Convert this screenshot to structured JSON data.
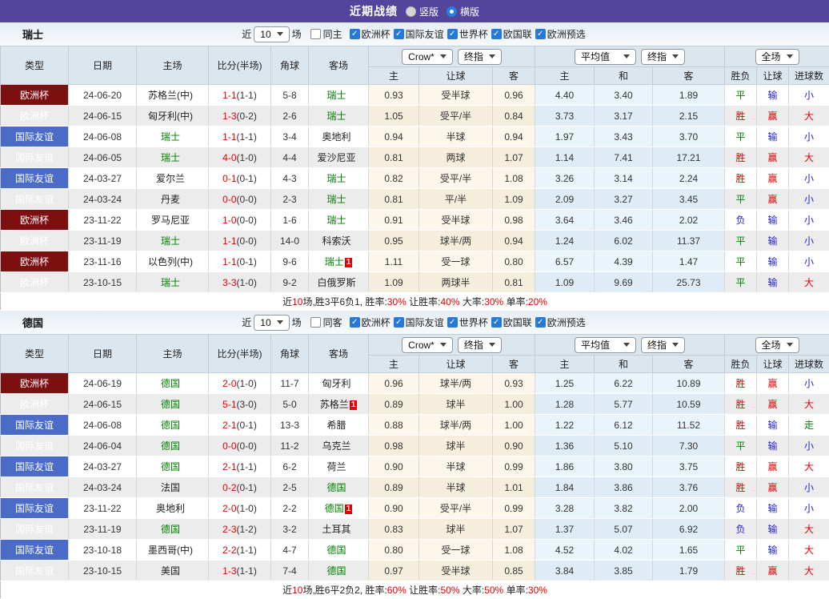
{
  "topbar": {
    "title": "近期战绩",
    "radios": [
      {
        "label": "竖版",
        "checked": false
      },
      {
        "label": "横版",
        "checked": true
      }
    ]
  },
  "columns": {
    "left": [
      "类型",
      "日期",
      "主场",
      "比分(半场)",
      "角球",
      "客场"
    ],
    "sub": [
      "主",
      "让球",
      "客",
      "主",
      "和",
      "客",
      "胜负",
      "让球",
      "进球数"
    ]
  },
  "colors": {
    "topbar_purple": "#53459b",
    "cup_red": "#7d0f10",
    "friendly_blue": "#4a6cc8",
    "win_red": "#e60000",
    "draw_green": "#008000",
    "lose_blue": "#2323cc",
    "checkbox_blue": "#2779d8"
  },
  "sections": [
    {
      "team": "瑞士",
      "filter": {
        "near": "近",
        "count": "10",
        "unit": "场",
        "same_side": "同主",
        "leagues": [
          "欧洲杯",
          "国际友谊",
          "世界杯",
          "欧国联",
          "欧洲预选"
        ]
      },
      "dropdowns": [
        "Crow*",
        "终指",
        "平均值",
        "终指",
        "全场"
      ],
      "rows": [
        {
          "league": "欧洲杯",
          "lc": "cup",
          "date": "24-06-20",
          "home": "苏格兰(中)",
          "home_focus": false,
          "home_card": null,
          "score": "1-1",
          "half": "(1-1)",
          "corner": "5-8",
          "away": "瑞士",
          "away_focus": true,
          "away_card": null,
          "odds_home": "0.93",
          "handicap": "受半球",
          "odds_away": "0.96",
          "avg_home": "4.40",
          "avg_draw": "3.40",
          "avg_away": "1.89",
          "result": {
            "t": "平",
            "c": "g"
          },
          "asian_result": {
            "t": "输",
            "c": "b"
          },
          "goals": {
            "t": "小",
            "c": "b"
          }
        },
        {
          "league": "欧洲杯",
          "lc": "cup",
          "date": "24-06-15",
          "home": "匈牙利(中)",
          "home_focus": false,
          "home_card": null,
          "score": "1-3",
          "half": "(0-2)",
          "corner": "2-6",
          "away": "瑞士",
          "away_focus": true,
          "away_card": null,
          "odds_home": "1.05",
          "handicap": "受平/半",
          "odds_away": "0.84",
          "avg_home": "3.73",
          "avg_draw": "3.17",
          "avg_away": "2.15",
          "result": {
            "t": "胜",
            "c": "r"
          },
          "asian_result": {
            "t": "赢",
            "c": "r"
          },
          "goals": {
            "t": "大",
            "c": "r"
          }
        },
        {
          "league": "国际友谊",
          "lc": "fr",
          "date": "24-06-08",
          "home": "瑞士",
          "home_focus": true,
          "home_card": null,
          "score": "1-1",
          "half": "(1-1)",
          "corner": "3-4",
          "away": "奥地利",
          "away_focus": false,
          "away_card": null,
          "odds_home": "0.94",
          "handicap": "半球",
          "odds_away": "0.94",
          "avg_home": "1.97",
          "avg_draw": "3.43",
          "avg_away": "3.70",
          "result": {
            "t": "平",
            "c": "g"
          },
          "asian_result": {
            "t": "输",
            "c": "b"
          },
          "goals": {
            "t": "小",
            "c": "b"
          }
        },
        {
          "league": "国际友谊",
          "lc": "fr",
          "date": "24-06-05",
          "home": "瑞士",
          "home_focus": true,
          "home_card": null,
          "score": "4-0",
          "half": "(1-0)",
          "corner": "4-4",
          "away": "爱沙尼亚",
          "away_focus": false,
          "away_card": null,
          "odds_home": "0.81",
          "handicap": "两球",
          "odds_away": "1.07",
          "avg_home": "1.14",
          "avg_draw": "7.41",
          "avg_away": "17.21",
          "result": {
            "t": "胜",
            "c": "r"
          },
          "asian_result": {
            "t": "赢",
            "c": "r"
          },
          "goals": {
            "t": "大",
            "c": "r"
          }
        },
        {
          "league": "国际友谊",
          "lc": "fr",
          "date": "24-03-27",
          "home": "爱尔兰",
          "home_focus": false,
          "home_card": null,
          "score": "0-1",
          "half": "(0-1)",
          "corner": "4-3",
          "away": "瑞士",
          "away_focus": true,
          "away_card": null,
          "odds_home": "0.82",
          "handicap": "受平/半",
          "odds_away": "1.08",
          "avg_home": "3.26",
          "avg_draw": "3.14",
          "avg_away": "2.24",
          "result": {
            "t": "胜",
            "c": "r"
          },
          "asian_result": {
            "t": "赢",
            "c": "r"
          },
          "goals": {
            "t": "小",
            "c": "b"
          }
        },
        {
          "league": "国际友谊",
          "lc": "fr",
          "date": "24-03-24",
          "home": "丹麦",
          "home_focus": false,
          "home_card": null,
          "score": "0-0",
          "half": "(0-0)",
          "corner": "2-3",
          "away": "瑞士",
          "away_focus": true,
          "away_card": null,
          "odds_home": "0.81",
          "handicap": "平/半",
          "odds_away": "1.09",
          "avg_home": "2.09",
          "avg_draw": "3.27",
          "avg_away": "3.45",
          "result": {
            "t": "平",
            "c": "g"
          },
          "asian_result": {
            "t": "赢",
            "c": "r"
          },
          "goals": {
            "t": "小",
            "c": "b"
          }
        },
        {
          "league": "欧洲杯",
          "lc": "cup",
          "date": "23-11-22",
          "home": "罗马尼亚",
          "home_focus": false,
          "home_card": null,
          "score": "1-0",
          "half": "(0-0)",
          "corner": "1-6",
          "away": "瑞士",
          "away_focus": true,
          "away_card": null,
          "odds_home": "0.91",
          "handicap": "受半球",
          "odds_away": "0.98",
          "avg_home": "3.64",
          "avg_draw": "3.46",
          "avg_away": "2.02",
          "result": {
            "t": "负",
            "c": "b"
          },
          "asian_result": {
            "t": "输",
            "c": "b"
          },
          "goals": {
            "t": "小",
            "c": "b"
          }
        },
        {
          "league": "欧洲杯",
          "lc": "cup",
          "date": "23-11-19",
          "home": "瑞士",
          "home_focus": true,
          "home_card": null,
          "score": "1-1",
          "half": "(0-0)",
          "corner": "14-0",
          "away": "科索沃",
          "away_focus": false,
          "away_card": null,
          "odds_home": "0.95",
          "handicap": "球半/两",
          "odds_away": "0.94",
          "avg_home": "1.24",
          "avg_draw": "6.02",
          "avg_away": "11.37",
          "result": {
            "t": "平",
            "c": "g"
          },
          "asian_result": {
            "t": "输",
            "c": "b"
          },
          "goals": {
            "t": "小",
            "c": "b"
          }
        },
        {
          "league": "欧洲杯",
          "lc": "cup",
          "date": "23-11-16",
          "home": "以色列(中)",
          "home_focus": false,
          "home_card": null,
          "score": "1-1",
          "half": "(0-1)",
          "corner": "9-6",
          "away": "瑞士",
          "away_focus": true,
          "away_card": "1",
          "odds_home": "1.11",
          "handicap": "受一球",
          "odds_away": "0.80",
          "avg_home": "6.57",
          "avg_draw": "4.39",
          "avg_away": "1.47",
          "result": {
            "t": "平",
            "c": "g"
          },
          "asian_result": {
            "t": "输",
            "c": "b"
          },
          "goals": {
            "t": "小",
            "c": "b"
          }
        },
        {
          "league": "欧洲杯",
          "lc": "cup",
          "date": "23-10-15",
          "home": "瑞士",
          "home_focus": true,
          "home_card": null,
          "score": "3-3",
          "half": "(1-0)",
          "corner": "9-2",
          "away": "白俄罗斯",
          "away_focus": false,
          "away_card": null,
          "odds_home": "1.09",
          "handicap": "两球半",
          "odds_away": "0.81",
          "avg_home": "1.09",
          "avg_draw": "9.69",
          "avg_away": "25.73",
          "result": {
            "t": "平",
            "c": "g"
          },
          "asian_result": {
            "t": "输",
            "c": "b"
          },
          "goals": {
            "t": "大",
            "c": "r"
          }
        }
      ],
      "summary": [
        [
          "近",
          "k"
        ],
        [
          "10",
          "r"
        ],
        [
          "场,胜3平6负1, 胜率:",
          "k"
        ],
        [
          "30%",
          "r"
        ],
        [
          " 让胜率:",
          "k"
        ],
        [
          "40%",
          "r"
        ],
        [
          " 大率:",
          "k"
        ],
        [
          "30%",
          "r"
        ],
        [
          " 单率:",
          "k"
        ],
        [
          "20%",
          "r"
        ]
      ]
    },
    {
      "team": "德国",
      "filter": {
        "near": "近",
        "count": "10",
        "unit": "场",
        "same_side": "同客",
        "leagues": [
          "欧洲杯",
          "国际友谊",
          "世界杯",
          "欧国联",
          "欧洲预选"
        ]
      },
      "dropdowns": [
        "Crow*",
        "终指",
        "平均值",
        "终指",
        "全场"
      ],
      "rows": [
        {
          "league": "欧洲杯",
          "lc": "cup",
          "date": "24-06-19",
          "home": "德国",
          "home_focus": true,
          "home_card": null,
          "score": "2-0",
          "half": "(1-0)",
          "corner": "11-7",
          "away": "匈牙利",
          "away_focus": false,
          "away_card": null,
          "odds_home": "0.96",
          "handicap": "球半/两",
          "odds_away": "0.93",
          "avg_home": "1.25",
          "avg_draw": "6.22",
          "avg_away": "10.89",
          "result": {
            "t": "胜",
            "c": "r"
          },
          "asian_result": {
            "t": "赢",
            "c": "r"
          },
          "goals": {
            "t": "小",
            "c": "b"
          }
        },
        {
          "league": "欧洲杯",
          "lc": "cup",
          "date": "24-06-15",
          "home": "德国",
          "home_focus": true,
          "home_card": null,
          "score": "5-1",
          "half": "(3-0)",
          "corner": "5-0",
          "away": "苏格兰",
          "away_focus": false,
          "away_card": "1",
          "odds_home": "0.89",
          "handicap": "球半",
          "odds_away": "1.00",
          "avg_home": "1.28",
          "avg_draw": "5.77",
          "avg_away": "10.59",
          "result": {
            "t": "胜",
            "c": "r"
          },
          "asian_result": {
            "t": "赢",
            "c": "r"
          },
          "goals": {
            "t": "大",
            "c": "r"
          }
        },
        {
          "league": "国际友谊",
          "lc": "fr",
          "date": "24-06-08",
          "home": "德国",
          "home_focus": true,
          "home_card": null,
          "score": "2-1",
          "half": "(0-1)",
          "corner": "13-3",
          "away": "希腊",
          "away_focus": false,
          "away_card": null,
          "odds_home": "0.88",
          "handicap": "球半/两",
          "odds_away": "1.00",
          "avg_home": "1.22",
          "avg_draw": "6.12",
          "avg_away": "11.52",
          "result": {
            "t": "胜",
            "c": "r"
          },
          "asian_result": {
            "t": "输",
            "c": "b"
          },
          "goals": {
            "t": "走",
            "c": "g"
          }
        },
        {
          "league": "国际友谊",
          "lc": "fr",
          "date": "24-06-04",
          "home": "德国",
          "home_focus": true,
          "home_card": null,
          "score": "0-0",
          "half": "(0-0)",
          "corner": "11-2",
          "away": "乌克兰",
          "away_focus": false,
          "away_card": null,
          "odds_home": "0.98",
          "handicap": "球半",
          "odds_away": "0.90",
          "avg_home": "1.36",
          "avg_draw": "5.10",
          "avg_away": "7.30",
          "result": {
            "t": "平",
            "c": "g"
          },
          "asian_result": {
            "t": "输",
            "c": "b"
          },
          "goals": {
            "t": "小",
            "c": "b"
          }
        },
        {
          "league": "国际友谊",
          "lc": "fr",
          "date": "24-03-27",
          "home": "德国",
          "home_focus": true,
          "home_card": null,
          "score": "2-1",
          "half": "(1-1)",
          "corner": "6-2",
          "away": "荷兰",
          "away_focus": false,
          "away_card": null,
          "odds_home": "0.90",
          "handicap": "半球",
          "odds_away": "0.99",
          "avg_home": "1.86",
          "avg_draw": "3.80",
          "avg_away": "3.75",
          "result": {
            "t": "胜",
            "c": "r"
          },
          "asian_result": {
            "t": "赢",
            "c": "r"
          },
          "goals": {
            "t": "大",
            "c": "r"
          }
        },
        {
          "league": "国际友谊",
          "lc": "fr",
          "date": "24-03-24",
          "home": "法国",
          "home_focus": false,
          "home_card": null,
          "score": "0-2",
          "half": "(0-1)",
          "corner": "2-5",
          "away": "德国",
          "away_focus": true,
          "away_card": null,
          "odds_home": "0.89",
          "handicap": "半球",
          "odds_away": "1.01",
          "avg_home": "1.84",
          "avg_draw": "3.86",
          "avg_away": "3.76",
          "result": {
            "t": "胜",
            "c": "r"
          },
          "asian_result": {
            "t": "赢",
            "c": "r"
          },
          "goals": {
            "t": "小",
            "c": "b"
          }
        },
        {
          "league": "国际友谊",
          "lc": "fr",
          "date": "23-11-22",
          "home": "奥地利",
          "home_focus": false,
          "home_card": null,
          "score": "2-0",
          "half": "(1-0)",
          "corner": "2-2",
          "away": "德国",
          "away_focus": true,
          "away_card": "1",
          "odds_home": "0.90",
          "handicap": "受平/半",
          "odds_away": "0.99",
          "avg_home": "3.28",
          "avg_draw": "3.82",
          "avg_away": "2.00",
          "result": {
            "t": "负",
            "c": "b"
          },
          "asian_result": {
            "t": "输",
            "c": "b"
          },
          "goals": {
            "t": "小",
            "c": "b"
          }
        },
        {
          "league": "国际友谊",
          "lc": "fr",
          "date": "23-11-19",
          "home": "德国",
          "home_focus": true,
          "home_card": null,
          "score": "2-3",
          "half": "(1-2)",
          "corner": "3-2",
          "away": "土耳其",
          "away_focus": false,
          "away_card": null,
          "odds_home": "0.83",
          "handicap": "球半",
          "odds_away": "1.07",
          "avg_home": "1.37",
          "avg_draw": "5.07",
          "avg_away": "6.92",
          "result": {
            "t": "负",
            "c": "b"
          },
          "asian_result": {
            "t": "输",
            "c": "b"
          },
          "goals": {
            "t": "大",
            "c": "r"
          }
        },
        {
          "league": "国际友谊",
          "lc": "fr",
          "date": "23-10-18",
          "home": "墨西哥(中)",
          "home_focus": false,
          "home_card": null,
          "score": "2-2",
          "half": "(1-1)",
          "corner": "4-7",
          "away": "德国",
          "away_focus": true,
          "away_card": null,
          "odds_home": "0.80",
          "handicap": "受一球",
          "odds_away": "1.08",
          "avg_home": "4.52",
          "avg_draw": "4.02",
          "avg_away": "1.65",
          "result": {
            "t": "平",
            "c": "g"
          },
          "asian_result": {
            "t": "输",
            "c": "b"
          },
          "goals": {
            "t": "大",
            "c": "r"
          }
        },
        {
          "league": "国际友谊",
          "lc": "fr",
          "date": "23-10-15",
          "home": "美国",
          "home_focus": false,
          "home_card": null,
          "score": "1-3",
          "half": "(1-1)",
          "corner": "7-4",
          "away": "德国",
          "away_focus": true,
          "away_card": null,
          "odds_home": "0.97",
          "handicap": "受半球",
          "odds_away": "0.85",
          "avg_home": "3.84",
          "avg_draw": "3.85",
          "avg_away": "1.79",
          "result": {
            "t": "胜",
            "c": "r"
          },
          "asian_result": {
            "t": "赢",
            "c": "r"
          },
          "goals": {
            "t": "大",
            "c": "r"
          }
        }
      ],
      "summary": [
        [
          "近",
          "k"
        ],
        [
          "10",
          "r"
        ],
        [
          "场,胜6平2负2, 胜率:",
          "k"
        ],
        [
          "60%",
          "r"
        ],
        [
          " 让胜率:",
          "k"
        ],
        [
          "50%",
          "r"
        ],
        [
          " 大率:",
          "k"
        ],
        [
          "50%",
          "r"
        ],
        [
          " 单率:",
          "k"
        ],
        [
          "30%",
          "r"
        ]
      ]
    }
  ]
}
